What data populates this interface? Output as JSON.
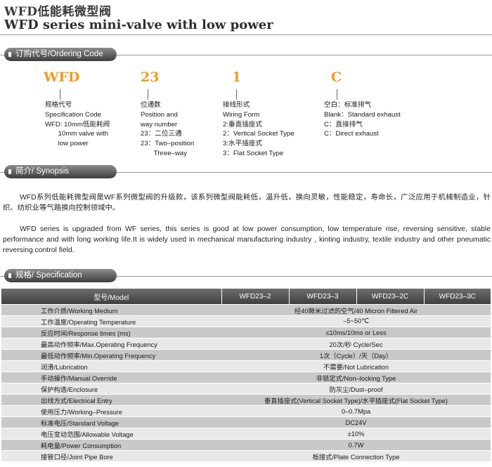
{
  "title": {
    "cn": "WFD低能耗微型阀",
    "en": "WFD series mini-valve with low power"
  },
  "sections": {
    "ordering": "订购代号/Ordering Code",
    "synopsis": "简介/ Synopsis",
    "specification": "规格/ Specification"
  },
  "ordering_code": [
    {
      "letter": "WFD",
      "desc": "规格代号\nSpecification Code\nWFD: 10mm低能耗阀\n       10mm valve with\n       low power"
    },
    {
      "letter": "23",
      "desc": "位通数\nPosition and\nway number\n23：二位三通\n23：Two–position\n       Three–way"
    },
    {
      "letter": "1",
      "desc": "接线形式\nWiring Form\n2:垂直插座式\n2：Vertical Socket Type\n3:水平插座式\n3：Flat Socket Type"
    },
    {
      "letter": "C",
      "desc": "空白：标准排气\nBlank：Standard exhaust\nC：直接排气\nC：Direct exhaust"
    }
  ],
  "synopsis": {
    "cn": "WFD系列低能耗微型阀是WF系列微型阀的升级款，该系列微型阀能耗低，温升低，换向灵敏，性能稳定，寿命长，广泛应用于机械制造业，针织、纺织业等气路换向控制领域中。",
    "en": "WFD series is upgraded from WF series, this series is good at low power consumption, low temperature rise, reversing sensitive, stable performance and with long working life.It is widely used in mechanical manufacturing industry , kinting industry, textile industry and other pneumatic reversing control field."
  },
  "spec_table": {
    "headers": [
      "型号/Model",
      "WFD23–2",
      "WFD23–3",
      "WFD23–2C",
      "WFD23–3C"
    ],
    "rows": [
      {
        "label": "工作介质/Working Medium",
        "value": "经40微米过滤的空气/40 Micron Filtered Air"
      },
      {
        "label": "工作温度/Operating Temperature",
        "value": "–5~50℃"
      },
      {
        "label": "反应时间/Response times (ms)",
        "value": "≤10ms/10ms or Less"
      },
      {
        "label": "最高动作频率/Max.Operating Frequency",
        "value": "20次/秒 Cycle/Sec"
      },
      {
        "label": "最低动作频率/Min.Operating Frequency",
        "value": "1次（Cycle）/天（Day）"
      },
      {
        "label": "润滑/Lubrication",
        "value": "不需要/Not Lubrication"
      },
      {
        "label": "手动操作/Manual Override",
        "value": "非锁定式/Non–locking Type"
      },
      {
        "label": "保护构造/Enclosure",
        "value": "防灰尘/Dust–proof"
      },
      {
        "label": "出线方式/Electrical Entry",
        "value": "垂直插座式(Vertical Socket Type)/水平插座式(Flat Socket Type)"
      },
      {
        "label": "使用压力/Working–Pressure",
        "value": "0–0.7Mpa"
      },
      {
        "label": "标准电压/Standard Voltage",
        "value": "DC24V"
      },
      {
        "label": "电压变动范围/Allowable Voltage",
        "value": "±10%"
      },
      {
        "label": "耗电量/Power Consumption",
        "value": "0.7W"
      },
      {
        "label": "接管口径/Joint Pipe Bore",
        "value": "板接式/Plate Connection Type"
      }
    ]
  },
  "colors": {
    "accent_orange": "#f39a1e",
    "tab_dark": "#3d3d3d",
    "row_odd": "#c9c9c9",
    "row_even": "#e8e8e8"
  }
}
